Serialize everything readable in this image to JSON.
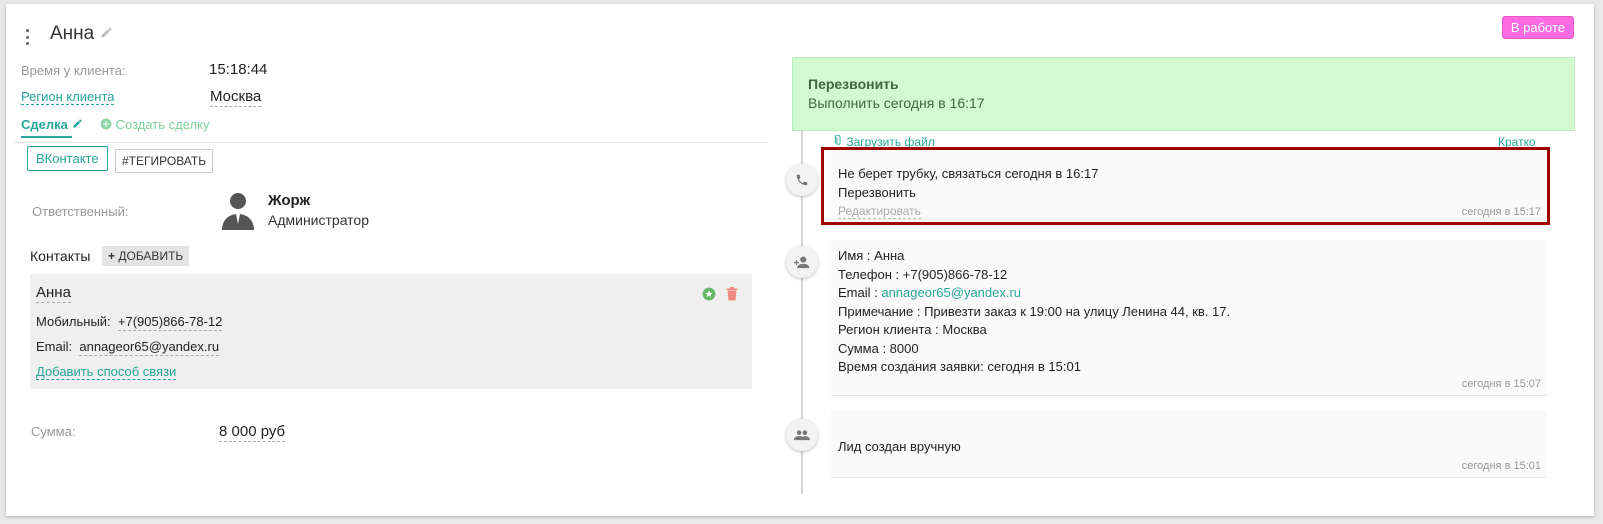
{
  "header": {
    "title": "Анна",
    "status": "В работе"
  },
  "info": {
    "client_time_label": "Время у клиента:",
    "client_time_value": "15:18:44",
    "region_label": "Регион клиента",
    "region_value": "Москва"
  },
  "tabs": {
    "deal": "Сделка",
    "create_deal": "Создать сделку"
  },
  "tags": {
    "source": "ВКонтакте",
    "tag_button": "#ТЕГИРОВАТЬ"
  },
  "responsible": {
    "label": "Ответственный:",
    "name": "Жорж",
    "role": "Администратор"
  },
  "contacts": {
    "label": "Контакты",
    "add_button": "ДОБАВИТЬ",
    "name": "Анна",
    "mobile_label": "Мобильный:",
    "mobile_value": "+7(905)866-78-12",
    "email_label": "Email:",
    "email_value": "annageor65@yandex.ru",
    "add_method": "Добавить способ связи"
  },
  "sum": {
    "label": "Сумма:",
    "value": "8 000 руб"
  },
  "task": {
    "title": "Перезвонить",
    "subtitle": "Выполнить сегодня в 16:17"
  },
  "timeline_toolbar": {
    "upload": "Загрузить файл",
    "short": "Кратко"
  },
  "timeline": {
    "call": {
      "line1": "Не берет трубку, связаться сегодня в 16:17",
      "line2": "Перезвонить",
      "edit": "Редактировать",
      "time": "сегодня в 15:17"
    },
    "details": {
      "name": "Имя : Анна",
      "phone": "Телефон : +7(905)866-78-12",
      "email_label": "Email : ",
      "email_value": "annageor65@yandex.ru",
      "note": "Примечание : Привезти заказ к 19:00 на улицу Ленина 44, кв. 17.",
      "region": "Регион клиента : Москва",
      "sum": "Сумма : 8000",
      "created": "Время создания заявки: сегодня в 15:01",
      "time": "сегодня в 15:07"
    },
    "lead": {
      "text": "Лид создан вручную",
      "time": "сегодня в 15:01"
    }
  },
  "colors": {
    "accent": "#26a69a",
    "status": "#ff6be2",
    "task_bg": "#d3f9d3",
    "highlight_border": "#a00000"
  }
}
